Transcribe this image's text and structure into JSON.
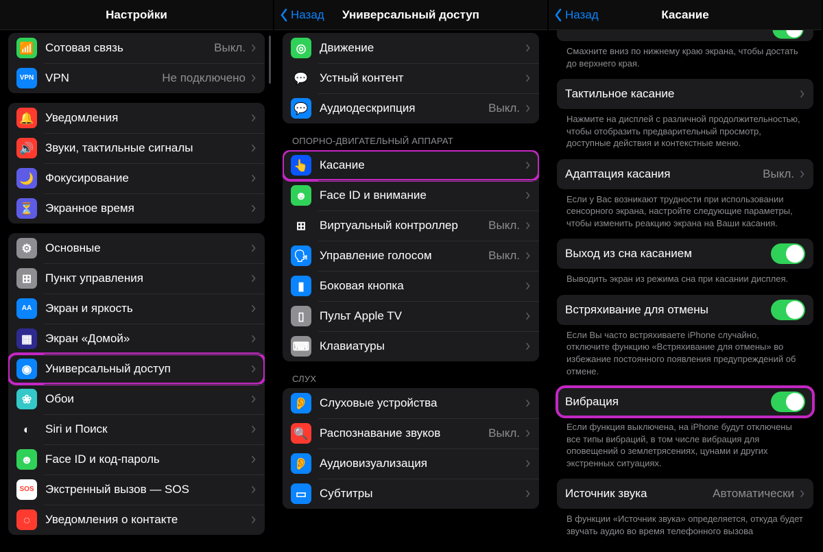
{
  "pane1": {
    "title": "Настройки",
    "groups": [
      {
        "rows": [
          {
            "id": "cellular",
            "icon": "📶",
            "bg": "#30d158",
            "label": "Сотовая связь",
            "value": "Выкл."
          },
          {
            "id": "vpn",
            "icon": "VPN",
            "bg": "#0a84ff",
            "label": "VPN",
            "value": "Не подключено",
            "iconSmall": true
          }
        ]
      },
      {
        "rows": [
          {
            "id": "notifications",
            "icon": "🔔",
            "bg": "#ff3b30",
            "label": "Уведомления"
          },
          {
            "id": "sounds",
            "icon": "🔊",
            "bg": "#ff3b30",
            "label": "Звуки, тактильные сигналы"
          },
          {
            "id": "focus",
            "icon": "🌙",
            "bg": "#5e5ce6",
            "label": "Фокусирование"
          },
          {
            "id": "screentime",
            "icon": "⏳",
            "bg": "#5e5ce6",
            "label": "Экранное время"
          }
        ]
      },
      {
        "rows": [
          {
            "id": "general",
            "icon": "⚙︎",
            "bg": "#8e8e93",
            "label": "Основные"
          },
          {
            "id": "controlcenter",
            "icon": "⊞",
            "bg": "#8e8e93",
            "label": "Пункт управления"
          },
          {
            "id": "display",
            "icon": "AA",
            "bg": "#0a84ff",
            "label": "Экран и яркость",
            "iconSmall": true
          },
          {
            "id": "home",
            "icon": "▦",
            "bg": "#2e2a8f",
            "label": "Экран «Домой»"
          },
          {
            "id": "accessibility",
            "icon": "◉",
            "bg": "#0a84ff",
            "label": "Универсальный доступ",
            "highlight": true
          },
          {
            "id": "wallpaper",
            "icon": "❀",
            "bg": "#34c8c8",
            "label": "Обои"
          },
          {
            "id": "siri",
            "icon": "◐",
            "bg": "#1c1c1e",
            "label": "Siri и Поиск"
          },
          {
            "id": "faceid",
            "icon": "☻",
            "bg": "#30d158",
            "label": "Face ID и код-пароль"
          },
          {
            "id": "sos",
            "icon": "SOS",
            "bg": "#ffffff",
            "fg": "#ff3b30",
            "label": "Экстренный вызов — SOS",
            "iconSmall": true
          },
          {
            "id": "exposure",
            "icon": "◌",
            "bg": "#ff3b30",
            "label": "Уведомления о контакте"
          }
        ]
      }
    ]
  },
  "pane2": {
    "back": "Назад",
    "title": "Универсальный доступ",
    "partialTop": [
      {
        "id": "motion",
        "icon": "◎",
        "bg": "#30d158",
        "label": "Движение"
      },
      {
        "id": "spoken",
        "icon": "💬",
        "bg": "#1c1c1e",
        "label": "Устный контент"
      },
      {
        "id": "audiodesc",
        "icon": "💬",
        "bg": "#0a84ff",
        "label": "Аудиодескрипция",
        "value": "Выкл."
      }
    ],
    "motorHeader": "ОПОРНО-ДВИГАТЕЛЬНЫЙ АППАРАТ",
    "motor": [
      {
        "id": "touch",
        "icon": "👆",
        "bg": "#0a57ff",
        "label": "Касание",
        "highlight": true
      },
      {
        "id": "faceid2",
        "icon": "☻",
        "bg": "#30d158",
        "label": "Face ID и внимание"
      },
      {
        "id": "switch",
        "icon": "⊞",
        "bg": "#1c1c1e",
        "label": "Виртуальный контроллер",
        "value": "Выкл."
      },
      {
        "id": "voice",
        "icon": "🗣",
        "bg": "#0a84ff",
        "label": "Управление голосом",
        "value": "Выкл."
      },
      {
        "id": "sidebtn",
        "icon": "▮",
        "bg": "#0a84ff",
        "label": "Боковая кнопка"
      },
      {
        "id": "appletv",
        "icon": "▯",
        "bg": "#8e8e93",
        "label": "Пульт Apple TV"
      },
      {
        "id": "keyboard2",
        "icon": "⌨",
        "bg": "#8e8e93",
        "label": "Клавиатуры"
      }
    ],
    "hearingHeader": "СЛУХ",
    "hearing": [
      {
        "id": "hearingdev",
        "icon": "👂",
        "bg": "#0a84ff",
        "label": "Слуховые устройства"
      },
      {
        "id": "soundrec",
        "icon": "🔍",
        "bg": "#ff3b30",
        "label": "Распознавание звуков",
        "value": "Выкл."
      },
      {
        "id": "audiovis",
        "icon": "👂",
        "bg": "#0a84ff",
        "label": "Аудиовизуализация"
      },
      {
        "id": "subtitles",
        "icon": "▭",
        "bg": "#0a84ff",
        "label": "Субтитры"
      }
    ]
  },
  "pane3": {
    "back": "Назад",
    "title": "Касание",
    "topFooter": "Смахните вниз по нижнему краю экрана, чтобы достать до верхнего края.",
    "tactile": {
      "label": "Тактильное касание"
    },
    "tactileFooter": "Нажмите на дисплей с различной продолжительностью, чтобы отобразить предварительный просмотр, доступные действия и контекстные меню.",
    "adapt": {
      "label": "Адаптация касания",
      "value": "Выкл."
    },
    "adaptFooter": "Если у Вас возникают трудности при использовании сенсорного экрана, настройте следующие параметры, чтобы изменить реакцию экрана на Ваши касания.",
    "wake": {
      "label": "Выход из сна касанием",
      "on": true
    },
    "wakeFooter": "Выводить экран из режима сна при касании дисплея.",
    "shake": {
      "label": "Встряхивание для отмены",
      "on": true
    },
    "shakeFooter": "Если Вы часто встряхиваете iPhone случайно, отключите функцию «Встряхивание для отмены» во избежание постоянного появления предупреждений об отмене.",
    "vibration": {
      "label": "Вибрация",
      "on": true,
      "highlight": true
    },
    "vibrationFooter": "Если функция выключена, на iPhone будут отключены все типы вибраций, в том числе вибрация для оповещений о землетрясениях, цунами и других экстренных ситуациях.",
    "source": {
      "label": "Источник звука",
      "value": "Автоматически"
    },
    "sourceFooter": "В функции «Источник звука» определяется, откуда будет звучать аудио во время телефонного вызова"
  }
}
